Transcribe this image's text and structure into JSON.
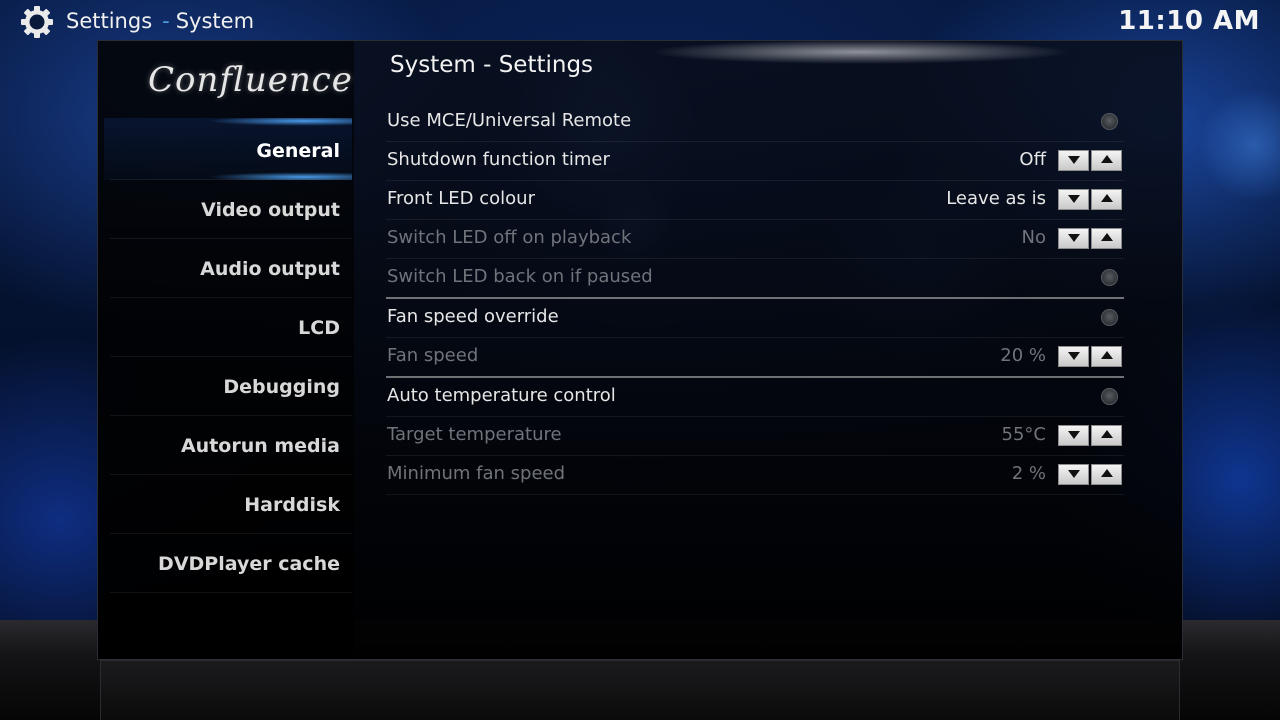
{
  "header": {
    "section": "Settings",
    "separator": "-",
    "subsection": "System",
    "clock": "11:10 AM"
  },
  "skin_logo": "Confluence",
  "sidebar": {
    "items": [
      {
        "label": "General",
        "active": true
      },
      {
        "label": "Video output",
        "active": false
      },
      {
        "label": "Audio output",
        "active": false
      },
      {
        "label": "LCD",
        "active": false
      },
      {
        "label": "Debugging",
        "active": false
      },
      {
        "label": "Autorun media",
        "active": false
      },
      {
        "label": "Harddisk",
        "active": false
      },
      {
        "label": "DVDPlayer cache",
        "active": false
      }
    ]
  },
  "main": {
    "title": "System - Settings",
    "settings": [
      {
        "label": "Use MCE/Universal Remote",
        "control": "radio",
        "enabled": true
      },
      {
        "label": "Shutdown function timer",
        "value": "Off",
        "control": "spin",
        "enabled": true
      },
      {
        "label": "Front LED colour",
        "value": "Leave as is",
        "control": "spin",
        "enabled": true
      },
      {
        "label": "Switch LED off on playback",
        "value": "No",
        "control": "spin",
        "enabled": false
      },
      {
        "label": "Switch LED back on if paused",
        "control": "radio",
        "enabled": false
      },
      {
        "label": "Fan speed override",
        "control": "radio",
        "enabled": true
      },
      {
        "label": "Fan speed",
        "value": "20 %",
        "control": "spin",
        "enabled": false
      },
      {
        "label": "Auto temperature control",
        "control": "radio",
        "enabled": true
      },
      {
        "label": "Target temperature",
        "value": "55°C",
        "control": "spin",
        "enabled": false
      },
      {
        "label": "Minimum fan speed",
        "value": "2 %",
        "control": "spin",
        "enabled": false
      }
    ]
  },
  "colors": {
    "accent": "#4a9de0",
    "text": "#e6e6e6",
    "disabled_text": "#6f737a"
  }
}
